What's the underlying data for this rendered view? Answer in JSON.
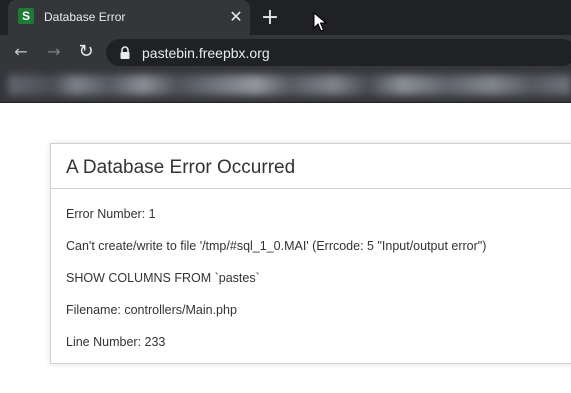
{
  "browser": {
    "tab_title": "Database Error",
    "favicon_letter": "S",
    "close_glyph": "✕",
    "new_tab_glyph": "+",
    "url": "pastebin.freepbx.org",
    "back_glyph": "←",
    "forward_glyph": "→",
    "reload_glyph": "↻",
    "icons": [
      "back-icon",
      "forward-icon",
      "reload-icon",
      "lock-icon",
      "close-icon",
      "plus-icon"
    ]
  },
  "error": {
    "title": "A Database Error Occurred",
    "lines": [
      "Error Number: 1",
      "Can't create/write to file '/tmp/#sql_1_0.MAI' (Errcode: 5 \"Input/output error\")",
      "SHOW COLUMNS FROM `pastes`",
      "Filename: controllers/Main.php",
      "Line Number: 233"
    ]
  },
  "colors": {
    "chrome_dark": "#202124",
    "chrome_tab": "#35363a",
    "favicon_green": "#1e7b34",
    "text": "#333333",
    "border": "#d0d0d0"
  }
}
